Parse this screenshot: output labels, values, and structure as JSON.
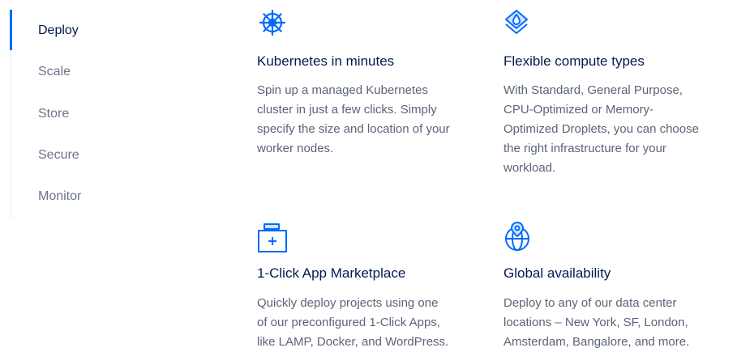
{
  "sidebar": {
    "items": [
      {
        "label": "Deploy",
        "active": true
      },
      {
        "label": "Scale",
        "active": false
      },
      {
        "label": "Store",
        "active": false
      },
      {
        "label": "Secure",
        "active": false
      },
      {
        "label": "Monitor",
        "active": false
      }
    ]
  },
  "features": [
    {
      "icon": "kubernetes-helm-icon",
      "title": "Kubernetes in minutes",
      "lines": [
        "Spin up a managed Kubernetes",
        "cluster in just a few clicks. Simply",
        "specify the size and location of your",
        "worker nodes."
      ]
    },
    {
      "icon": "layered-droplet-icon",
      "title": "Flexible compute types",
      "lines": [
        "With Standard, General Purpose,",
        "CPU-Optimized or Memory-",
        "Optimized Droplets, you can choose",
        "the right infrastructure for your",
        "workload."
      ]
    },
    {
      "icon": "marketplace-box-icon",
      "title": "1-Click App Marketplace",
      "lines": [
        "Quickly deploy projects using one",
        "of our preconfigured 1-Click Apps,",
        "like LAMP, Docker, and WordPress."
      ]
    },
    {
      "icon": "globe-pin-icon",
      "title": "Global availability",
      "lines": [
        "Deploy to any of our data center",
        "locations – New York, SF, London,",
        "Amsterdam, Bangalore, and more."
      ]
    }
  ],
  "colors": {
    "accent": "#0069ff",
    "heading": "#031b4e",
    "body": "#5b6478",
    "nav_inactive": "#6b7488"
  }
}
